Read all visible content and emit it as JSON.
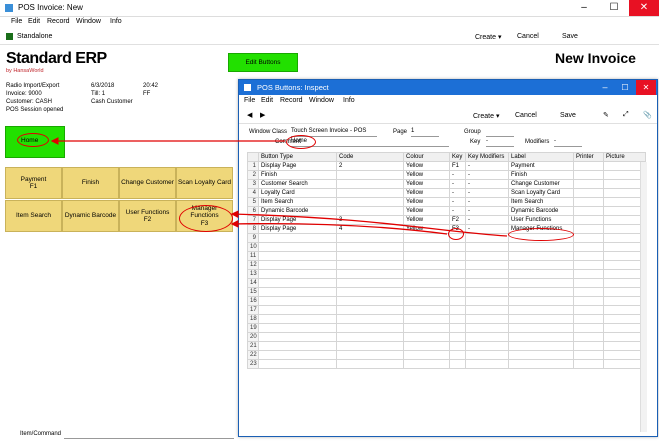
{
  "main": {
    "title": "POS Invoice: New",
    "menu": [
      "File",
      "Edit",
      "Record",
      "Window",
      "Info"
    ],
    "standalone": "Standalone",
    "toolbar": {
      "create": "Create",
      "cancel": "Cancel",
      "save": "Save"
    },
    "logo_main": "Standard ERP",
    "logo_sub": "by HansaWorld",
    "edit_buttons": "Edit Buttons",
    "page_title": "New Invoice",
    "info": {
      "radio": "Radio Import/Export",
      "date": "6/3/2018",
      "time": "20:42",
      "invoice": "Invoice: 9000",
      "till": "Till: 1",
      "ff": "FF",
      "customer": "Customer: CASH",
      "customer_name": "Cash Customer",
      "session": "POS Session opened"
    },
    "home_button": "Home",
    "buttons_row1": [
      {
        "l1": "Payment",
        "l2": "F1"
      },
      {
        "l1": "Finish",
        "l2": ""
      },
      {
        "l1": "Change Customer",
        "l2": ""
      },
      {
        "l1": "Scan Loyalty Card",
        "l2": ""
      }
    ],
    "buttons_row2": [
      {
        "l1": "Item Search",
        "l2": ""
      },
      {
        "l1": "Dynamic Barcode",
        "l2": ""
      },
      {
        "l1": "User Functions",
        "l2": "F2"
      },
      {
        "l1": "Manager Functions",
        "l2": "F3"
      }
    ],
    "item_command_label": "Item/Command"
  },
  "inspector": {
    "title": "POS Buttons: Inspect",
    "menu": [
      "File",
      "Edit",
      "Record",
      "Window",
      "Info"
    ],
    "toolbar": {
      "create": "Create",
      "cancel": "Cancel",
      "save": "Save"
    },
    "window_class_label": "Window Class",
    "window_class_value": "Touch Screen Invoice - POS",
    "page_label": "Page",
    "page_value": "1",
    "group_label": "Group",
    "comment_label": "Comment",
    "comment_value": "Home",
    "key_label": "Key",
    "key_value": "-",
    "modifiers_label": "Modifiers",
    "modifiers_value": "-",
    "columns": [
      "Button Type",
      "Code",
      "Colour",
      "Key",
      "Key Modifiers",
      "Label",
      "Printer",
      "Picture"
    ],
    "rows": [
      [
        "1",
        "Display Page",
        "2",
        "Yellow",
        "F1",
        "-",
        "Payment",
        "",
        ""
      ],
      [
        "2",
        "Finish",
        "",
        "Yellow",
        "-",
        "-",
        "Finish",
        "",
        ""
      ],
      [
        "3",
        "Customer Search",
        "",
        "Yellow",
        "-",
        "-",
        "Change Customer",
        "",
        ""
      ],
      [
        "4",
        "Loyalty Card",
        "",
        "Yellow",
        "-",
        "-",
        "Scan Loyalty Card",
        "",
        ""
      ],
      [
        "5",
        "Item Search",
        "",
        "Yellow",
        "-",
        "-",
        "Item Search",
        "",
        ""
      ],
      [
        "6",
        "Dynamic Barcode",
        "",
        "Yellow",
        "-",
        "-",
        "Dynamic Barcode",
        "",
        ""
      ],
      [
        "7",
        "Display Page",
        "3",
        "Yellow",
        "F2",
        "-",
        "User Functions",
        "",
        ""
      ],
      [
        "8",
        "Display Page",
        "4",
        "Yellow",
        "F3",
        "-",
        "Manager Functions",
        "",
        ""
      ],
      [
        "9",
        "",
        "",
        "",
        "",
        "",
        "",
        "",
        ""
      ],
      [
        "10",
        "",
        "",
        "",
        "",
        "",
        "",
        "",
        ""
      ],
      [
        "11",
        "",
        "",
        "",
        "",
        "",
        "",
        "",
        ""
      ],
      [
        "12",
        "",
        "",
        "",
        "",
        "",
        "",
        "",
        ""
      ],
      [
        "13",
        "",
        "",
        "",
        "",
        "",
        "",
        "",
        ""
      ],
      [
        "14",
        "",
        "",
        "",
        "",
        "",
        "",
        "",
        ""
      ],
      [
        "15",
        "",
        "",
        "",
        "",
        "",
        "",
        "",
        ""
      ],
      [
        "16",
        "",
        "",
        "",
        "",
        "",
        "",
        "",
        ""
      ],
      [
        "17",
        "",
        "",
        "",
        "",
        "",
        "",
        "",
        ""
      ],
      [
        "18",
        "",
        "",
        "",
        "",
        "",
        "",
        "",
        ""
      ],
      [
        "19",
        "",
        "",
        "",
        "",
        "",
        "",
        "",
        ""
      ],
      [
        "20",
        "",
        "",
        "",
        "",
        "",
        "",
        "",
        ""
      ],
      [
        "21",
        "",
        "",
        "",
        "",
        "",
        "",
        "",
        ""
      ],
      [
        "22",
        "",
        "",
        "",
        "",
        "",
        "",
        "",
        ""
      ],
      [
        "23",
        "",
        "",
        "",
        "",
        "",
        "",
        "",
        ""
      ]
    ]
  },
  "colors": {
    "green": "#22e000",
    "yellow": "#efd77a",
    "titlebar": "#1c6fd6",
    "annotation": "#e00000"
  }
}
